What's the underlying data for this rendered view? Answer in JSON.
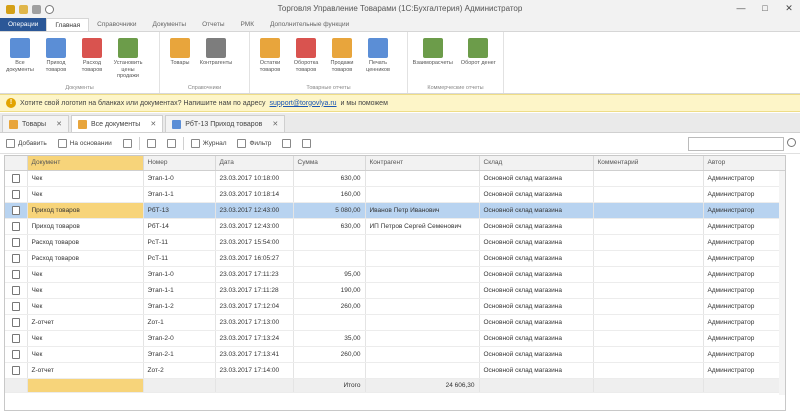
{
  "window": {
    "title": "Торговля Управление Товарами (1С:Бухгалтерия) Администратор",
    "buttons": [
      "—",
      "□",
      "✕"
    ]
  },
  "ribbon_tabs": [
    "Операции",
    "Главная",
    "Справочники",
    "Документы",
    "Отчеты",
    "РМК",
    "Дополнительные функции"
  ],
  "ribbon_groups": [
    {
      "title": "Документы",
      "buttons": [
        {
          "label": "Все документы",
          "color": "#5b8ed6"
        },
        {
          "label": "Приход товаров",
          "color": "#5b8ed6"
        },
        {
          "label": "Расход товаров",
          "color": "#d9534f"
        },
        {
          "label": "Установить цены продажи",
          "color": "#6c9c4a"
        }
      ]
    },
    {
      "title": "Справочники",
      "buttons": [
        {
          "label": "Товары",
          "color": "#e8a53c"
        },
        {
          "label": "Контрагенты",
          "color": "#7d7d7d"
        }
      ]
    },
    {
      "title": "Товарные отчеты",
      "buttons": [
        {
          "label": "Остатки товаров",
          "color": "#e8a53c"
        },
        {
          "label": "Оборотка товаров",
          "color": "#d9534f"
        },
        {
          "label": "Продажи товаров",
          "color": "#e8a53c"
        },
        {
          "label": "Печать ценников",
          "color": "#5b8ed6"
        }
      ]
    },
    {
      "title": "Коммерческие отчеты",
      "buttons": [
        {
          "label": "Взаиморасчеты",
          "color": "#6c9c4a"
        },
        {
          "label": "Оборот денег",
          "color": "#6c9c4a"
        }
      ]
    }
  ],
  "infobar": {
    "text": "Хотите свой логотип на бланках или документах? Напишите нам по адресу",
    "link": "support@torgovlya.ru",
    "suffix": "и мы поможем"
  },
  "doc_tabs": [
    {
      "label": "Товары",
      "active": false,
      "color": "#e8a53c"
    },
    {
      "label": "Все документы",
      "active": true,
      "color": "#e8a53c"
    },
    {
      "label": "РбТ-13 Приход товаров",
      "active": false,
      "color": "#5b8ed6"
    }
  ],
  "toolbar": {
    "add": "Добавить",
    "copy": "На основании",
    "journal": "Журнал",
    "filter": "Фильтр"
  },
  "grid": {
    "columns": [
      "Документ",
      "Номер",
      "Дата",
      "Сумма",
      "Контрагент",
      "Склад",
      "Комментарий",
      "Автор"
    ],
    "rows": [
      {
        "doc": "Чек",
        "num": "Этап-1-0",
        "date": "23.03.2017 10:18:00",
        "sum": "630,00",
        "partner": "",
        "store": "Основной склад магазина",
        "comment": "",
        "author": "Администратор"
      },
      {
        "doc": "Чек",
        "num": "Этап-1-1",
        "date": "23.03.2017 10:18:14",
        "sum": "160,00",
        "partner": "",
        "store": "Основной склад магазина",
        "comment": "",
        "author": "Администратор"
      },
      {
        "doc": "Приход товаров",
        "num": "РбТ-13",
        "date": "23.03.2017 12:43:00",
        "sum": "5 080,00",
        "partner": "Иванов Петр Иванович",
        "store": "Основной склад магазина",
        "comment": "",
        "author": "Администратор"
      },
      {
        "doc": "Приход товаров",
        "num": "РбТ-14",
        "date": "23.03.2017 12:43:00",
        "sum": "630,00",
        "partner": "ИП Петров Сергей Семенович",
        "store": "Основной склад магазина",
        "comment": "",
        "author": "Администратор"
      },
      {
        "doc": "Расход товаров",
        "num": "РсТ-11",
        "date": "23.03.2017 15:54:00",
        "sum": "",
        "partner": "",
        "store": "Основной склад магазина",
        "comment": "",
        "author": "Администратор"
      },
      {
        "doc": "Расход товаров",
        "num": "РсТ-11",
        "date": "23.03.2017 16:05:27",
        "sum": "",
        "partner": "",
        "store": "Основной склад магазина",
        "comment": "",
        "author": "Администратор"
      },
      {
        "doc": "Чек",
        "num": "Этап-1-0",
        "date": "23.03.2017 17:11:23",
        "sum": "95,00",
        "partner": "",
        "store": "Основной склад магазина",
        "comment": "",
        "author": "Администратор"
      },
      {
        "doc": "Чек",
        "num": "Этап-1-1",
        "date": "23.03.2017 17:11:28",
        "sum": "190,00",
        "partner": "",
        "store": "Основной склад магазина",
        "comment": "",
        "author": "Администратор"
      },
      {
        "doc": "Чек",
        "num": "Этап-1-2",
        "date": "23.03.2017 17:12:04",
        "sum": "260,00",
        "partner": "",
        "store": "Основной склад магазина",
        "comment": "",
        "author": "Администратор"
      },
      {
        "doc": "Z-отчет",
        "num": "Zот-1",
        "date": "23.03.2017 17:13:00",
        "sum": "",
        "partner": "",
        "store": "Основной склад магазина",
        "comment": "",
        "author": "Администратор"
      },
      {
        "doc": "Чек",
        "num": "Этап-2-0",
        "date": "23.03.2017 17:13:24",
        "sum": "35,00",
        "partner": "",
        "store": "Основной склад магазина",
        "comment": "",
        "author": "Администратор"
      },
      {
        "doc": "Чек",
        "num": "Этап-2-1",
        "date": "23.03.2017 17:13:41",
        "sum": "260,00",
        "partner": "",
        "store": "Основной склад магазина",
        "comment": "",
        "author": "Администратор"
      },
      {
        "doc": "Z-отчет",
        "num": "Zот-2",
        "date": "23.03.2017 17:14:00",
        "sum": "",
        "partner": "",
        "store": "Основной склад магазина",
        "comment": "",
        "author": "Администратор"
      }
    ],
    "selected_index": 2,
    "footer": {
      "label": "Итого",
      "total": "24 606,30"
    }
  }
}
